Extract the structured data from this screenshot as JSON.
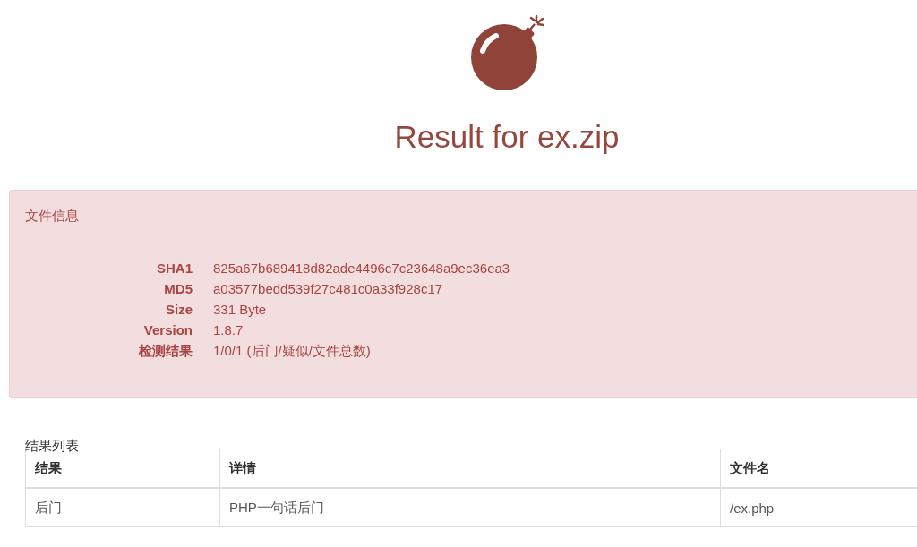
{
  "header": {
    "title": "Result for ex.zip"
  },
  "file_info": {
    "heading": "文件信息",
    "fields": [
      {
        "label": "SHA1",
        "value": "825a67b689418d82ade4496c7c23648a9ec36ea3"
      },
      {
        "label": "MD5",
        "value": "a03577bedd539f27c481c0a33f928c17"
      },
      {
        "label": "Size",
        "value": "331 Byte"
      },
      {
        "label": "Version",
        "value": "1.8.7"
      },
      {
        "label": "检测结果",
        "value": "1/0/1 (后门/疑似/文件总数)"
      }
    ]
  },
  "results": {
    "caption": "结果列表",
    "columns": [
      "结果",
      "详情",
      "文件名"
    ],
    "rows": [
      [
        "后门",
        "PHP一句话后门",
        "/ex.php"
      ]
    ]
  }
}
